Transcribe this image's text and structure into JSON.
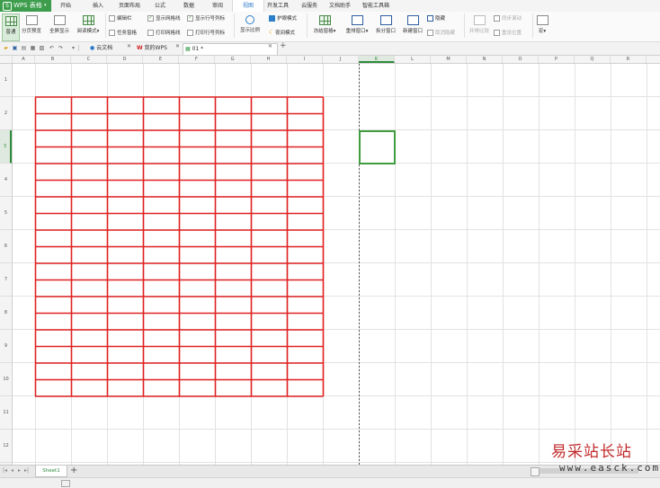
{
  "app": {
    "title": "WPS 表格",
    "logo_mark": "S"
  },
  "menu": {
    "items": [
      "开始",
      "插入",
      "页面布局",
      "公式",
      "数据",
      "审阅",
      "视图",
      "开发工具",
      "云服务",
      "文档助手",
      "智能工具箱"
    ],
    "active": "视图"
  },
  "ribbon": {
    "view_normal": "普通",
    "page_break_preview": "分页预览",
    "full_screen": "全屏显示",
    "read_mode": "阅读模式",
    "edit_bar": "编辑栏",
    "task_pane": "任务窗格",
    "show_gridlines": "显示网格线",
    "print_gridlines": "打印网格线",
    "show_headings": "显示行号列标",
    "print_headings": "打印行号列标",
    "zoom": "显示比例",
    "eye_protection": "护眼模式",
    "night_mode": "夜间模式",
    "freeze_panes": "冻结窗格",
    "arrange_windows": "重排窗口",
    "split_window": "拆分窗口",
    "new_window": "新建窗口",
    "hide": "隐藏",
    "unhide": "取消隐藏",
    "side_by_side": "并排比较",
    "sync_scroll": "同步滚动",
    "reset_position": "重设位置",
    "macro": "宏"
  },
  "tabs": {
    "cloud_docs": "云文档",
    "my_wps": "我的WPS",
    "current_file": "01 *",
    "add": "+"
  },
  "grid": {
    "column_headers": [
      "A",
      "B",
      "C",
      "D",
      "E",
      "F",
      "G",
      "H",
      "I",
      "J",
      "K",
      "L",
      "M",
      "N",
      "O",
      "P",
      "Q",
      "R"
    ],
    "active_column": "K",
    "row_headers": [
      "1",
      "2",
      "3",
      "4",
      "5",
      "6",
      "7",
      "8",
      "9",
      "10",
      "11",
      "12"
    ],
    "active_row": "3",
    "border_color": "#e02020",
    "selection_color": "#3f9d3f",
    "red_border_block": {
      "from_column": "B",
      "to_column": "I",
      "from_row": 2,
      "to_row": 10,
      "sub_rows_per_row": 2
    }
  },
  "sheets": {
    "tabs": [
      "Sheet1"
    ],
    "add": "+"
  },
  "watermark": {
    "cn": "易采站长站",
    "url": "www.easck.com"
  },
  "colors": {
    "brand": "#3d9d4d",
    "accent": "#2e8b3e",
    "menu_active_text": "#2d7dc8"
  }
}
